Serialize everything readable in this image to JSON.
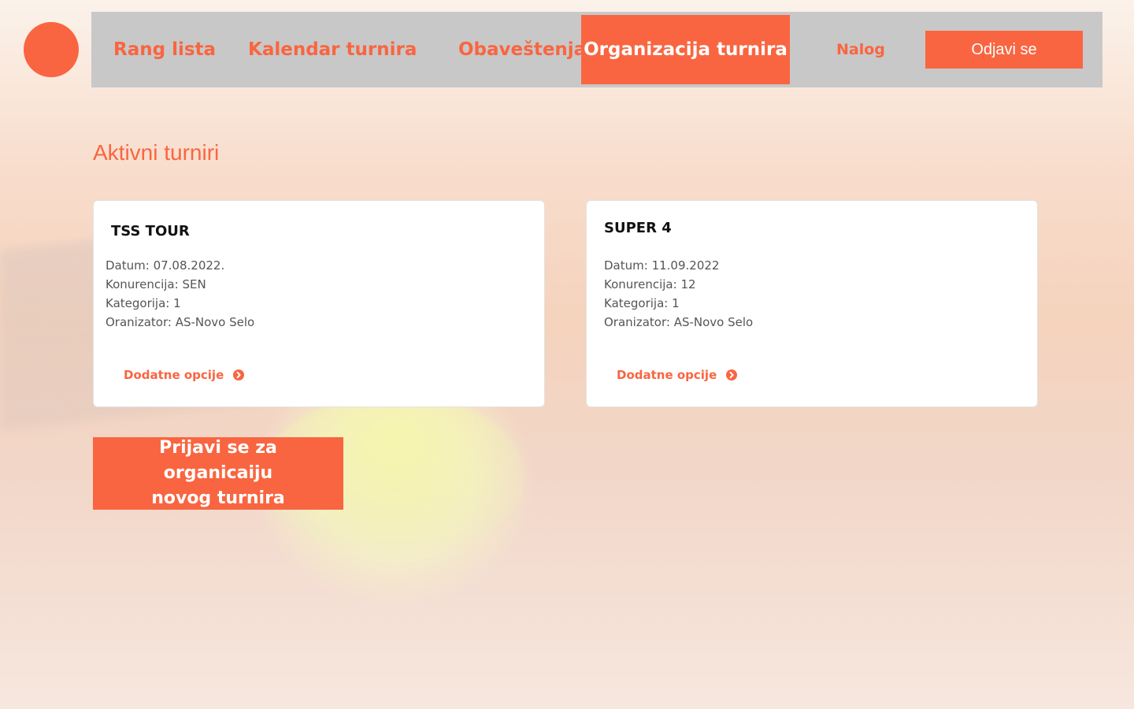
{
  "colors": {
    "accent": "#f96540",
    "navbar_bg": "#c8c8c8",
    "card_bg": "#ffffff",
    "card_text": "#555555",
    "card_title": "#111111"
  },
  "nav": {
    "items": [
      {
        "label": "Rang lista"
      },
      {
        "label": "Kalendar turnira"
      },
      {
        "label": "Obaveštenja"
      },
      {
        "label": "Organizacija turnira",
        "active": true
      },
      {
        "label": "Nalog"
      }
    ],
    "logout_label": "Odjavi se"
  },
  "main": {
    "title": "Aktivni turniri",
    "tournaments": [
      {
        "name": "TSS TOUR",
        "date": "Datum: 07.08.2022.",
        "competition": "Konurencija: SEN",
        "category": "Kategorija: 1",
        "organizer": "Oranizator: AS-Novo Selo",
        "link_label": "Dodatne opcije"
      },
      {
        "name": "SUPER 4",
        "date": "Datum: 11.09.2022",
        "competition": "Konurencija: 12",
        "category": "Kategorija: 1",
        "organizer": "Oranizator: AS-Novo Selo",
        "link_label": "Dodatne opcije"
      }
    ],
    "cta_line1": "Prijavi se za organicaiju",
    "cta_line2": "novog turnira"
  },
  "icons": {
    "logo": "logo-circle",
    "card_link_icon": "chevron-right-circle-icon"
  }
}
